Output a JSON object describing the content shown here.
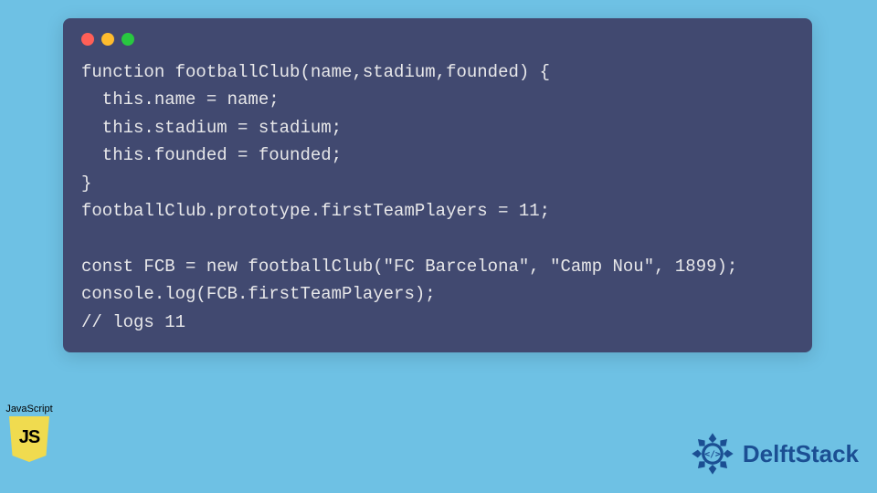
{
  "code": {
    "lines": [
      "function footballClub(name,stadium,founded) {",
      "  this.name = name;",
      "  this.stadium = stadium;",
      "  this.founded = founded;",
      "}",
      "footballClub.prototype.firstTeamPlayers = 11;",
      "",
      "const FCB = new footballClub(\"FC Barcelona\", \"Camp Nou\", 1899);",
      "console.log(FCB.firstTeamPlayers);",
      "// logs 11"
    ]
  },
  "js_badge": {
    "label": "JavaScript",
    "shield_text": "JS"
  },
  "brand": {
    "name": "DelftStack"
  },
  "colors": {
    "bg": "#6ec1e4",
    "window": "#414970",
    "js_yellow": "#f0db4f",
    "delft_blue": "#1b4f93"
  }
}
